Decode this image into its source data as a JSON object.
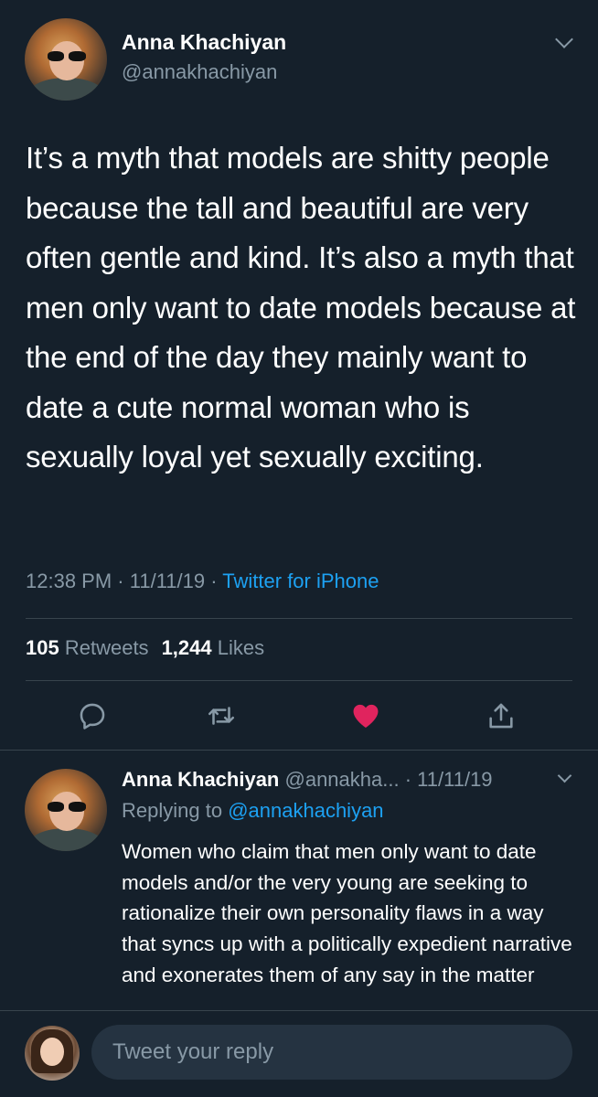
{
  "main_tweet": {
    "author_name": "Anna Khachiyan",
    "author_handle": "@annakhachiyan",
    "text": "It’s a myth that models are shitty people because the tall and beautiful are very often gentle and kind. It’s also a myth that men only want to date models because at the end of the day they mainly want to date a cute normal woman who is sexually loyal yet sexually exciting.",
    "time": "12:38 PM",
    "date": "11/11/19",
    "source": "Twitter for iPhone",
    "retweets_count": "105",
    "retweets_label": "Retweets",
    "likes_count": "1,244",
    "likes_label": "Likes",
    "liked": true
  },
  "actions": {
    "reply_icon": "reply-icon",
    "retweet_icon": "retweet-icon",
    "like_icon": "heart-icon",
    "share_icon": "share-icon"
  },
  "reply_tweet": {
    "author_name": "Anna Khachiyan",
    "author_handle": "@annakha...",
    "date": "11/11/19",
    "replying_label": "Replying to",
    "replying_to": "@annakhachiyan",
    "text": "Women who claim that men only want to date models and/or the very young are seeking to rationalize their own personality flaws in a way that syncs up with a politically expedient narrative and exonerates them of any say in the matter"
  },
  "composer": {
    "placeholder": "Tweet your reply"
  },
  "colors": {
    "background": "#15202b",
    "text_primary": "#ffffff",
    "text_secondary": "#8899a6",
    "link": "#1da1f2",
    "like": "#e0245e",
    "divider": "#38444d"
  }
}
